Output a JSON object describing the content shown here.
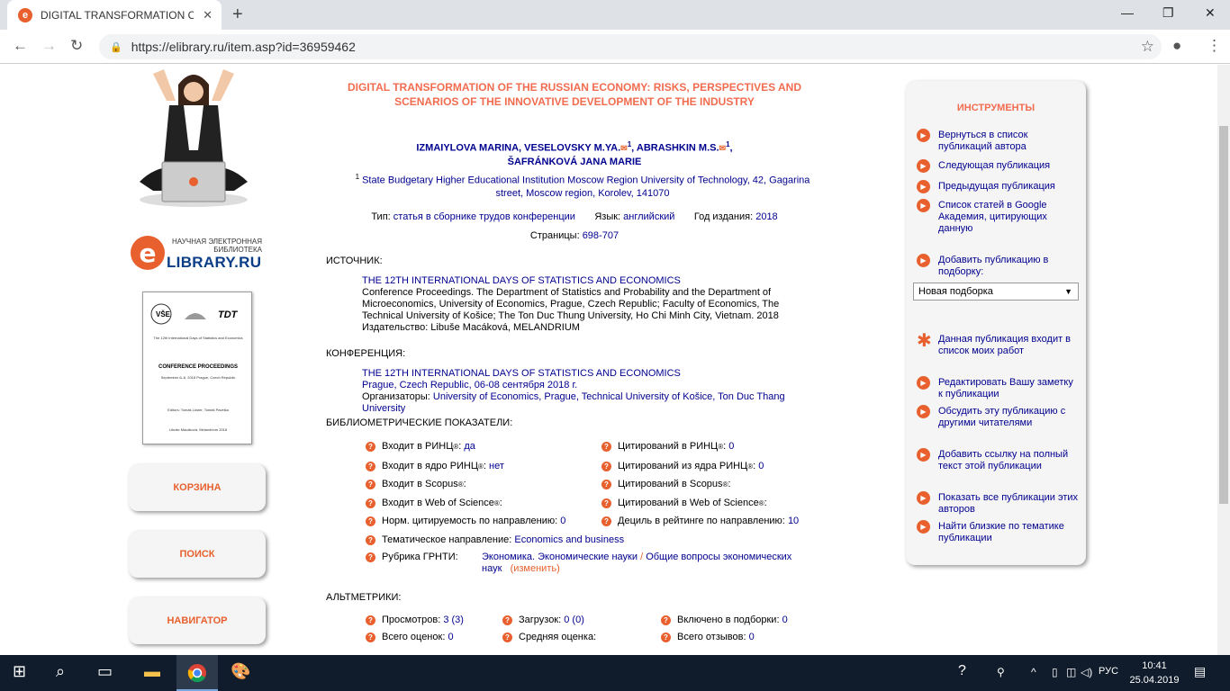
{
  "browser": {
    "tab_title": "DIGITAL TRANSFORMATION OF T",
    "favicon": "e",
    "url": "https://elibrary.ru/item.asp?id=36959462"
  },
  "logo": {
    "subtitle": "НАУЧНАЯ ЭЛЕКТРОННАЯ БИБЛИОТЕКА",
    "main": "LIBRARY.RU",
    "letter": "e"
  },
  "cover": {
    "line1": "The 12th International Days of Statistics and Economics",
    "title": "CONFERENCE PROCEEDINGS",
    "line2": "September 6–8, 2018 Prague, Czech Republic",
    "line3": "Editors: Tomáš Löster, Tomáš Pavelka",
    "line4": "Libuše Macáková, Melandrium 2018"
  },
  "sidebar": {
    "cart": "КОРЗИНА",
    "search": "ПОИСК",
    "navigator": "НАВИГАТОР"
  },
  "article": {
    "title": "DIGITAL TRANSFORMATION OF THE RUSSIAN ECONOMY: RISKS, PERSPECTIVES AND SCENARIOS OF THE INNOVATIVE DEVELOPMENT OF THE INDUSTRY",
    "author1": "IZMAIYLOVA MARINA",
    "author2": "VESELOVSKY M.YA.",
    "author3": "ABRASHKIN M.S.",
    "author4": "ŠAFRÁNKOVÁ JANA MARIE",
    "sup1": "1",
    "affil_sup": "1",
    "affiliation": "State Budgetary Higher Educational Institution Moscow Region University of Technology, 42, Gagarina street, Moscow region, Korolev, 141070",
    "type_label": "Тип:",
    "type_value": "статья в сборнике трудов конференции",
    "lang_label": "Язык:",
    "lang_value": "английский",
    "year_label": "Год издания:",
    "year_value": "2018",
    "pages_label": "Страницы:",
    "pages_value": "698-707"
  },
  "source": {
    "label": "ИСТОЧНИК:",
    "title": "THE 12TH INTERNATIONAL DAYS OF STATISTICS AND ECONOMICS",
    "desc": "Conference Proceedings. The Department of Statistics and Probability and the Department of Microeconomics, University of Economics, Prague, Czech Republic; Faculty of Economics, The Technical University of Košice; The Ton Duc Thung University, Ho Chi Minh City, Vietnam. 2018",
    "publisher": "Издательство: Libuše Macáková, MELANDRIUM"
  },
  "conference": {
    "label": "КОНФЕРЕНЦИЯ:",
    "title": "THE 12TH INTERNATIONAL DAYS OF STATISTICS AND ECONOMICS",
    "place": "Prague, Czech Republic, 06-08 сентября 2018 г.",
    "org_label": "Организаторы:",
    "org_value": "University of Economics, Prague, Technical University of Košice, Ton Duc Thang University"
  },
  "biblio": {
    "label": "БИБЛИОМЕТРИЧЕСКИЕ ПОКАЗАТЕЛИ:",
    "rinc": "Входит в РИНЦ",
    "rinc_v": "да",
    "core": "Входит в ядро РИНЦ",
    "core_v": "нет",
    "scopus": "Входит в Scopus",
    "wos": "Входит в Web of Science",
    "norm": "Норм. цитируемость по направлению:",
    "norm_v": "0",
    "cit_rinc": "Цитирований в РИНЦ",
    "cit_rinc_v": "0",
    "cit_core": "Цитирований из ядра РИНЦ",
    "cit_core_v": "0",
    "cit_scopus": "Цитирований в Scopus",
    "cit_wos": "Цитирований в Web of Science",
    "decile": "Дециль в рейтинге по направлению:",
    "decile_v": "10",
    "theme": "Тематическое направление:",
    "theme_v": "Economics and business",
    "rubric": "Рубрика ГРНТИ:",
    "rubric_v1": "Экономика. Экономические науки",
    "rubric_v2": "Общие вопросы экономических наук",
    "rubric_change": "изменить",
    "reg": "®"
  },
  "altmetrics": {
    "label": "АЛЬТМЕТРИКИ:",
    "views": "Просмотров:",
    "views_v": "3 (3)",
    "downloads": "Загрузок:",
    "downloads_v": "0 (0)",
    "collections": "Включено в подборки:",
    "collections_v": "0",
    "ratings": "Всего оценок:",
    "ratings_v": "0",
    "avg": "Средняя оценка:",
    "reviews": "Всего отзывов:",
    "reviews_v": "0"
  },
  "tools": {
    "title": "ИНСТРУМЕНТЫ",
    "back": "Вернуться в список публикаций автора",
    "next": "Следующая публикация",
    "prev": "Предыдущая публикация",
    "scholar": "Список статей в Google Академия, цитирующих данную",
    "add": "Добавить публикацию в подборку:",
    "select": "Новая подборка",
    "in_list": "Данная публикация входит в список моих работ",
    "note": "Редактировать Вашу заметку к публикации",
    "discuss": "Обсудить эту публикацию с другими читателями",
    "link": "Добавить ссылку на полный текст этой публикации",
    "show_all": "Показать все публикации этих авторов",
    "similar": "Найти близкие по тематике публикации"
  },
  "taskbar": {
    "lang": "РУС",
    "time": "10:41",
    "date": "25.04.2019"
  },
  "colors": {
    "accent": "#e8602e",
    "title": "#f26c4f",
    "link": "#00008f"
  }
}
